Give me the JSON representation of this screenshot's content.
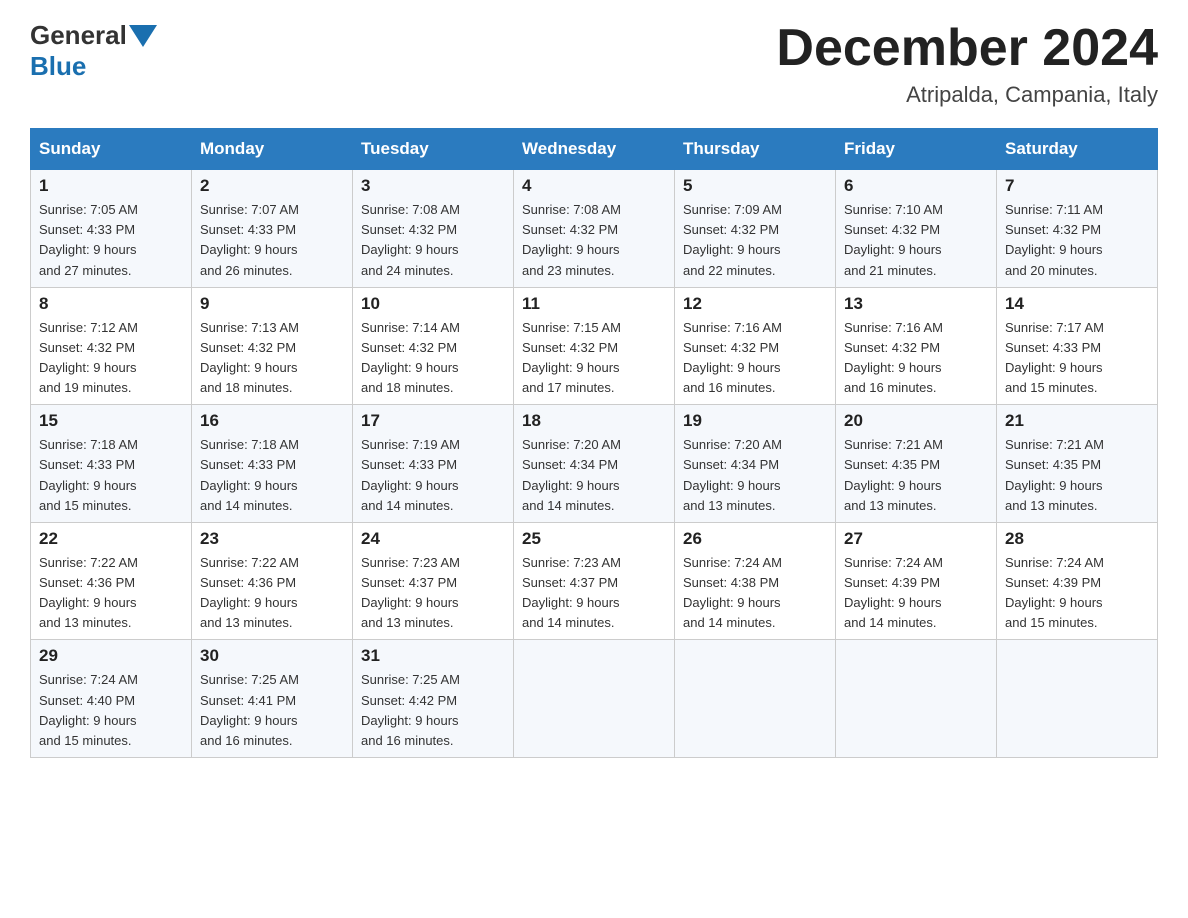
{
  "header": {
    "logo_general": "General",
    "logo_blue": "Blue",
    "month_title": "December 2024",
    "location": "Atripalda, Campania, Italy"
  },
  "weekdays": [
    "Sunday",
    "Monday",
    "Tuesday",
    "Wednesday",
    "Thursday",
    "Friday",
    "Saturday"
  ],
  "weeks": [
    [
      {
        "day": "1",
        "sunrise": "7:05 AM",
        "sunset": "4:33 PM",
        "daylight": "9 hours and 27 minutes."
      },
      {
        "day": "2",
        "sunrise": "7:07 AM",
        "sunset": "4:33 PM",
        "daylight": "9 hours and 26 minutes."
      },
      {
        "day": "3",
        "sunrise": "7:08 AM",
        "sunset": "4:32 PM",
        "daylight": "9 hours and 24 minutes."
      },
      {
        "day": "4",
        "sunrise": "7:08 AM",
        "sunset": "4:32 PM",
        "daylight": "9 hours and 23 minutes."
      },
      {
        "day": "5",
        "sunrise": "7:09 AM",
        "sunset": "4:32 PM",
        "daylight": "9 hours and 22 minutes."
      },
      {
        "day": "6",
        "sunrise": "7:10 AM",
        "sunset": "4:32 PM",
        "daylight": "9 hours and 21 minutes."
      },
      {
        "day": "7",
        "sunrise": "7:11 AM",
        "sunset": "4:32 PM",
        "daylight": "9 hours and 20 minutes."
      }
    ],
    [
      {
        "day": "8",
        "sunrise": "7:12 AM",
        "sunset": "4:32 PM",
        "daylight": "9 hours and 19 minutes."
      },
      {
        "day": "9",
        "sunrise": "7:13 AM",
        "sunset": "4:32 PM",
        "daylight": "9 hours and 18 minutes."
      },
      {
        "day": "10",
        "sunrise": "7:14 AM",
        "sunset": "4:32 PM",
        "daylight": "9 hours and 18 minutes."
      },
      {
        "day": "11",
        "sunrise": "7:15 AM",
        "sunset": "4:32 PM",
        "daylight": "9 hours and 17 minutes."
      },
      {
        "day": "12",
        "sunrise": "7:16 AM",
        "sunset": "4:32 PM",
        "daylight": "9 hours and 16 minutes."
      },
      {
        "day": "13",
        "sunrise": "7:16 AM",
        "sunset": "4:32 PM",
        "daylight": "9 hours and 16 minutes."
      },
      {
        "day": "14",
        "sunrise": "7:17 AM",
        "sunset": "4:33 PM",
        "daylight": "9 hours and 15 minutes."
      }
    ],
    [
      {
        "day": "15",
        "sunrise": "7:18 AM",
        "sunset": "4:33 PM",
        "daylight": "9 hours and 15 minutes."
      },
      {
        "day": "16",
        "sunrise": "7:18 AM",
        "sunset": "4:33 PM",
        "daylight": "9 hours and 14 minutes."
      },
      {
        "day": "17",
        "sunrise": "7:19 AM",
        "sunset": "4:33 PM",
        "daylight": "9 hours and 14 minutes."
      },
      {
        "day": "18",
        "sunrise": "7:20 AM",
        "sunset": "4:34 PM",
        "daylight": "9 hours and 14 minutes."
      },
      {
        "day": "19",
        "sunrise": "7:20 AM",
        "sunset": "4:34 PM",
        "daylight": "9 hours and 13 minutes."
      },
      {
        "day": "20",
        "sunrise": "7:21 AM",
        "sunset": "4:35 PM",
        "daylight": "9 hours and 13 minutes."
      },
      {
        "day": "21",
        "sunrise": "7:21 AM",
        "sunset": "4:35 PM",
        "daylight": "9 hours and 13 minutes."
      }
    ],
    [
      {
        "day": "22",
        "sunrise": "7:22 AM",
        "sunset": "4:36 PM",
        "daylight": "9 hours and 13 minutes."
      },
      {
        "day": "23",
        "sunrise": "7:22 AM",
        "sunset": "4:36 PM",
        "daylight": "9 hours and 13 minutes."
      },
      {
        "day": "24",
        "sunrise": "7:23 AM",
        "sunset": "4:37 PM",
        "daylight": "9 hours and 13 minutes."
      },
      {
        "day": "25",
        "sunrise": "7:23 AM",
        "sunset": "4:37 PM",
        "daylight": "9 hours and 14 minutes."
      },
      {
        "day": "26",
        "sunrise": "7:24 AM",
        "sunset": "4:38 PM",
        "daylight": "9 hours and 14 minutes."
      },
      {
        "day": "27",
        "sunrise": "7:24 AM",
        "sunset": "4:39 PM",
        "daylight": "9 hours and 14 minutes."
      },
      {
        "day": "28",
        "sunrise": "7:24 AM",
        "sunset": "4:39 PM",
        "daylight": "9 hours and 15 minutes."
      }
    ],
    [
      {
        "day": "29",
        "sunrise": "7:24 AM",
        "sunset": "4:40 PM",
        "daylight": "9 hours and 15 minutes."
      },
      {
        "day": "30",
        "sunrise": "7:25 AM",
        "sunset": "4:41 PM",
        "daylight": "9 hours and 16 minutes."
      },
      {
        "day": "31",
        "sunrise": "7:25 AM",
        "sunset": "4:42 PM",
        "daylight": "9 hours and 16 minutes."
      },
      null,
      null,
      null,
      null
    ]
  ],
  "labels": {
    "sunrise": "Sunrise:",
    "sunset": "Sunset:",
    "daylight": "Daylight:"
  }
}
